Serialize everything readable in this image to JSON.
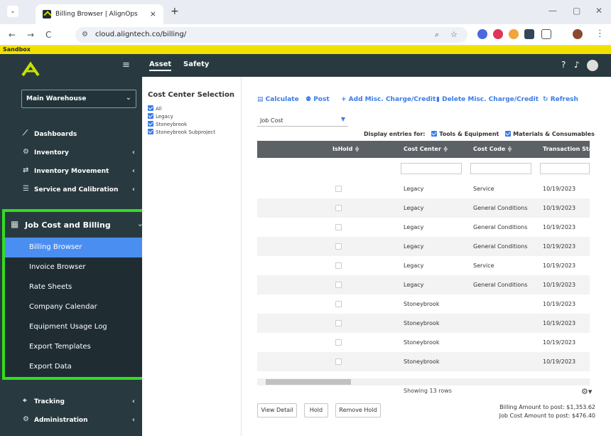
{
  "browser": {
    "tab_title": "Billing Browser | AlignOps",
    "url": "cloud.aligntech.co/billing/",
    "new_tab_symbol": "+",
    "tab_close_symbol": "×",
    "nav_back": "←",
    "nav_forward": "→",
    "nav_reload": "C",
    "menu_symbol": "⋮"
  },
  "sandbox_label": "Sandbox",
  "sidebar": {
    "warehouse": "Main Warehouse",
    "items": [
      {
        "label": "Dashboards",
        "icon": "chart-icon",
        "glyph": "⟋"
      },
      {
        "label": "Inventory",
        "icon": "inventory-icon",
        "glyph": "⚙"
      },
      {
        "label": "Inventory Movement",
        "icon": "arrows-icon",
        "glyph": "⇄"
      },
      {
        "label": "Service and Calibration",
        "icon": "list-icon",
        "glyph": "☰"
      }
    ],
    "job_cost": {
      "label": "Job Cost and Billing",
      "children": [
        "Billing Browser",
        "Invoice Browser",
        "Rate Sheets",
        "Company Calendar",
        "Equipment Usage Log",
        "Export Templates",
        "Export Data"
      ]
    },
    "bottom_items": [
      {
        "label": "Tracking",
        "icon": "tracking-icon",
        "glyph": "⌖"
      },
      {
        "label": "Administration",
        "icon": "admin-icon",
        "glyph": "⚙"
      }
    ]
  },
  "appbar": {
    "tabs": [
      "Asset",
      "Safety"
    ]
  },
  "cost_center": {
    "title": "Cost Center Selection",
    "items": [
      "All",
      "Legacy",
      "Stoneybrook",
      "Stoneybrook Subproject"
    ]
  },
  "toolbar": {
    "calculate": "Calculate",
    "post": "Post",
    "add_misc": "+ Add Misc. Charge/Credit",
    "delete_misc": "Delete Misc. Charge/Credit",
    "refresh": "Refresh"
  },
  "job_select": {
    "value": "Job Cost"
  },
  "display_entries": {
    "label": "Display entries for:",
    "options": [
      "Tools & Equipment",
      "Materials & Consumables"
    ]
  },
  "grid": {
    "columns": [
      "IsHold ≑",
      "Cost Center ≑",
      "Cost Code ≑",
      "Transaction Sta"
    ],
    "rows": [
      {
        "cost_center": "Legacy",
        "cost_code": "Service",
        "date": "10/19/2023"
      },
      {
        "cost_center": "Legacy",
        "cost_code": "General Conditions",
        "date": "10/19/2023"
      },
      {
        "cost_center": "Legacy",
        "cost_code": "General Conditions",
        "date": "10/19/2023"
      },
      {
        "cost_center": "Legacy",
        "cost_code": "General Conditions",
        "date": "10/19/2023"
      },
      {
        "cost_center": "Legacy",
        "cost_code": "Service",
        "date": "10/19/2023"
      },
      {
        "cost_center": "Legacy",
        "cost_code": "General Conditions",
        "date": "10/19/2023"
      },
      {
        "cost_center": "Stoneybrook",
        "cost_code": "",
        "date": "10/19/2023"
      },
      {
        "cost_center": "Stoneybrook",
        "cost_code": "",
        "date": "10/19/2023"
      },
      {
        "cost_center": "Stoneybrook",
        "cost_code": "",
        "date": "10/19/2023"
      },
      {
        "cost_center": "Stoneybrook",
        "cost_code": "",
        "date": "10/19/2023"
      }
    ]
  },
  "footer": {
    "showing": "Showing 13 rows",
    "view_detail": "View Detail",
    "hold": "Hold",
    "remove_hold": "Remove Hold",
    "billing_amount": "Billing Amount to post: $1,353.62",
    "job_cost_amount": "Job Cost Amount to post: $476.40"
  },
  "colors": {
    "accent": "#3b7be8",
    "sidebar": "#283a40",
    "highlight_box": "#33dd1f",
    "sandbox": "#f2e100"
  }
}
